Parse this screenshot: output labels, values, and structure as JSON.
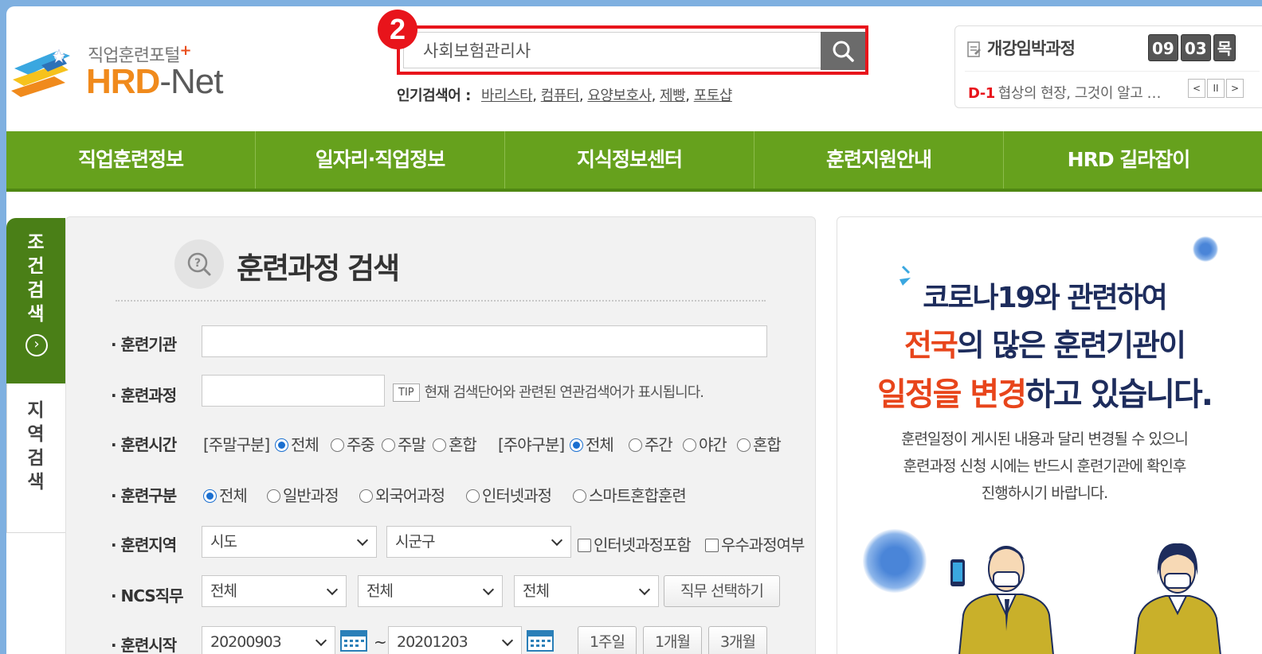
{
  "header": {
    "logo_sub": "직업훈련포털",
    "logo_main_hrd": "HRD",
    "logo_main_net": "-Net",
    "step_badge": "2",
    "search": {
      "value": "사회보험관리사"
    },
    "popular_label": "인기검색어 :",
    "popular_terms": [
      "바리스타",
      "컴퓨터",
      "요양보호사",
      "제빵",
      "포토샵"
    ]
  },
  "notice": {
    "title": "개강임박과정",
    "month": "09",
    "day": "03",
    "weekday": "목",
    "d_label": "D-1",
    "text": "협상의 현장, 그것이 알고 …",
    "ctrl_prev": "<",
    "ctrl_pause": "II",
    "ctrl_next": ">"
  },
  "nav": [
    "직업훈련정보",
    "일자리·직업정보",
    "지식정보센터",
    "훈련지원안내",
    "HRD 길라잡이"
  ],
  "side_tabs": {
    "condition": [
      "조",
      "건",
      "검",
      "색"
    ],
    "region": [
      "지",
      "역",
      "검",
      "색"
    ]
  },
  "form": {
    "title": "훈련과정 검색",
    "institution_label": "· 훈련기관",
    "course_label": "· 훈련과정",
    "tip": "TIP",
    "tip_text": "현재 검색단어와 관련된 연관검색어가 표시됩니다.",
    "time_label": "· 훈련시간",
    "weekend_group": "[주말구분]",
    "weekend_opts": [
      "전체",
      "주중",
      "주말",
      "혼합"
    ],
    "daynight_group": "[주야구분]",
    "daynight_opts": [
      "전체",
      "주간",
      "야간",
      "혼합"
    ],
    "type_label": "· 훈련구분",
    "type_opts": [
      "전체",
      "일반과정",
      "외국어과정",
      "인터넷과정",
      "스마트혼합훈련"
    ],
    "region_label": "· 훈련지역",
    "region_sido": "시도",
    "region_sigungu": "시군구",
    "include_internet": "인터넷과정포함",
    "excellent": "우수과정여부",
    "ncs_label": "· NCS직무",
    "ncs_1": "전체",
    "ncs_2": "전체",
    "ncs_3": "전체",
    "ncs_btn": "직무 선택하기",
    "start_label": "· 훈련시작",
    "start_from": "20200903",
    "tilde": "~",
    "start_to": "20201203",
    "period_btns": [
      "1주일",
      "1개월",
      "3개월"
    ]
  },
  "banner": {
    "line1": "코로나19와 관련하여",
    "line2_red": "전국",
    "line2_rest": "의 많은 훈련기관이",
    "line3_red": "일정을 변경",
    "line3_rest": "하고 있습니다.",
    "small1": "훈련일정이 게시된 내용과 달리 변경될 수 있으니",
    "small2": "훈련과정 신청 시에는 반드시 훈련기관에 확인후",
    "small3": "진행하시기 바랍니다."
  },
  "colors": {
    "nav_green": "#66a11d",
    "accent_red": "#e8141b",
    "logo_orange": "#f08a1c",
    "banner_navy": "#1d2c5c"
  }
}
